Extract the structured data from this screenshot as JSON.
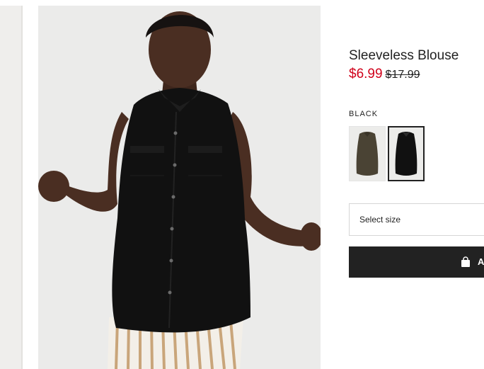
{
  "product": {
    "title": "Sleeveless Blouse",
    "price_sale": "$6.99",
    "price_original": "$17.99",
    "selected_color": "BLACK",
    "size_placeholder": "Select size",
    "add_button_label": "A"
  },
  "swatches": [
    {
      "name": "khaki-green",
      "color": "#4a4334",
      "selected": false
    },
    {
      "name": "black",
      "color": "#111111",
      "selected": true
    }
  ],
  "colors": {
    "sale_red": "#d0021b",
    "button_bg": "#222222",
    "text": "#222222"
  }
}
